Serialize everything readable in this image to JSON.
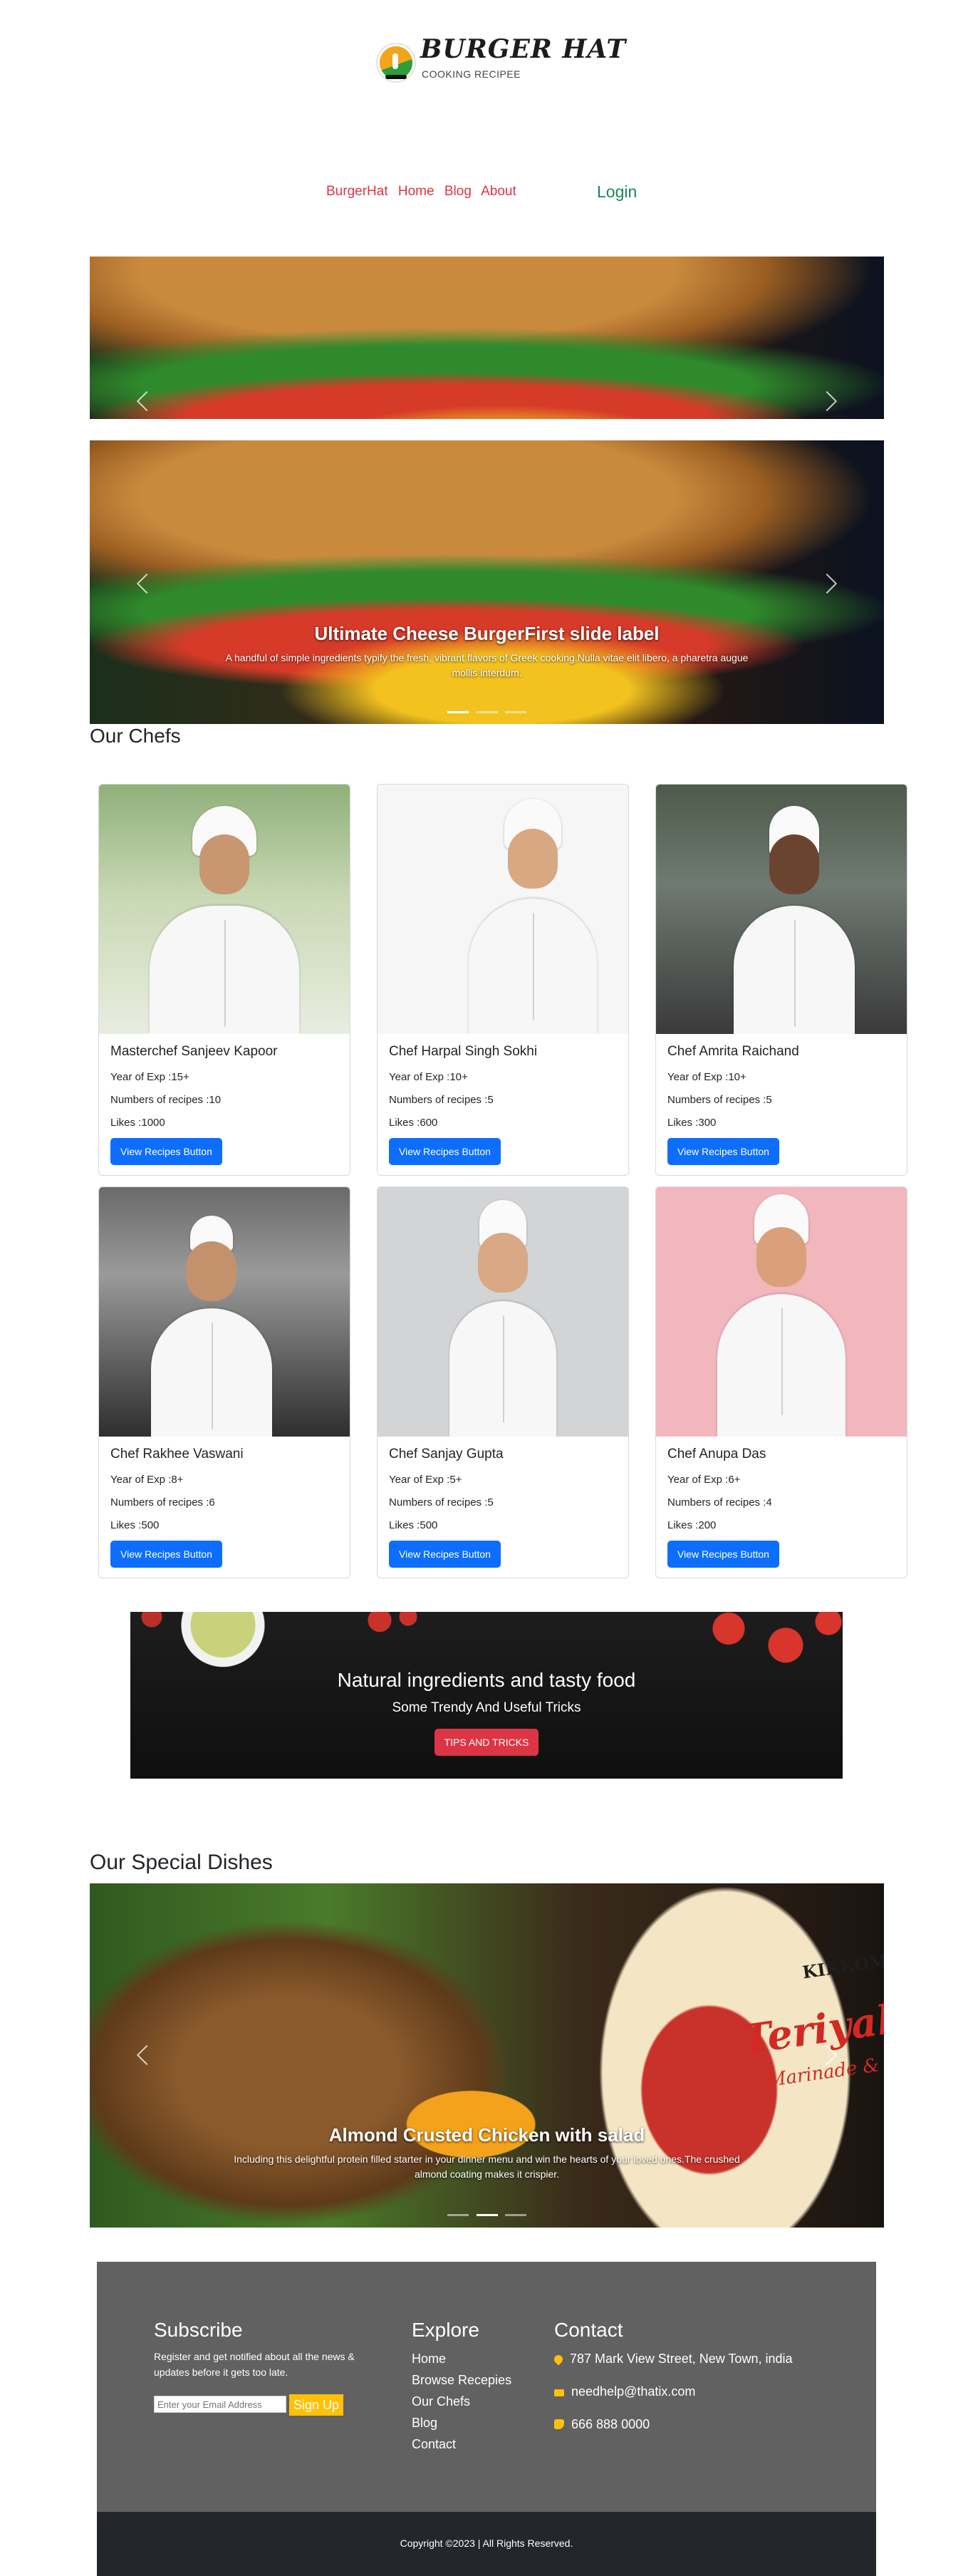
{
  "header": {
    "brand_title": "BURGER HAT",
    "brand_subtitle": "COOKING RECIPEE",
    "logo_icon": "burger-hat-logo-icon"
  },
  "nav": {
    "items": [
      "BurgerHat",
      "Home",
      "Blog",
      "About"
    ],
    "login": "Login"
  },
  "hero": {
    "caption_title": "Ultimate Cheese BurgerFirst slide label",
    "caption_text": "A handful of simple ingredients typify the fresh, vibrant flavors of Greek cooking.Nulla vitae elit libero, a pharetra augue mollis interdum."
  },
  "chefs_section": {
    "title": "Our Chefs",
    "exp_prefix": "Year of Exp :",
    "recipes_prefix": "Numbers of recipes :",
    "likes_prefix": "Likes :",
    "button_label": "View Recipes Button",
    "chefs": [
      {
        "name": "Masterchef Sanjeev Kapoor",
        "exp": "15+",
        "recipes": "10",
        "likes": "1000"
      },
      {
        "name": "Chef Harpal Singh Sokhi",
        "exp": "10+",
        "recipes": "5",
        "likes": "600"
      },
      {
        "name": "Chef Amrita Raichand",
        "exp": "10+",
        "recipes": "5",
        "likes": "300"
      },
      {
        "name": "Chef Rakhee Vaswani",
        "exp": "8+",
        "recipes": "6",
        "likes": "500"
      },
      {
        "name": "Chef Sanjay Gupta",
        "exp": "5+",
        "recipes": "5",
        "likes": "500"
      },
      {
        "name": "Chef Anupa Das",
        "exp": "6+",
        "recipes": "4",
        "likes": "200"
      }
    ]
  },
  "banner": {
    "title": "Natural ingredients and tasty food",
    "subtitle": "Some Trendy And Useful Tricks",
    "button_label": "TIPS AND TRICKS"
  },
  "dishes_section": {
    "title": "Our Special Dishes",
    "caption_title": "Almond Crusted Chicken with salad",
    "caption_text": "Including this delightful protein filled starter in your dinner menu and win the hearts of your loved ones.The crushed almond coating makes it crispier.",
    "bottle_brand": "KIKKOMAN",
    "bottle_name": "Teriyaki",
    "bottle_sub": "Marinade & Sauce"
  },
  "footer": {
    "subscribe_title": "Subscribe",
    "subscribe_text": "Register and get notified about all the news & updates before it gets too late.",
    "email_placeholder": "Enter your Email Address",
    "signup_label": "Sign Up",
    "explore_title": "Explore",
    "explore_links": [
      "Home",
      "Browse Recepies",
      "Our Chefs",
      "Blog",
      "Contact"
    ],
    "contact_title": "Contact",
    "address": "787 Mark View Street, New Town, india",
    "email": "needhelp@thatix.com",
    "phone": "666 888 0000",
    "copyright": "Copyright ©2023 | All Rights Reserved.",
    "accent_color": "#ffc107"
  }
}
